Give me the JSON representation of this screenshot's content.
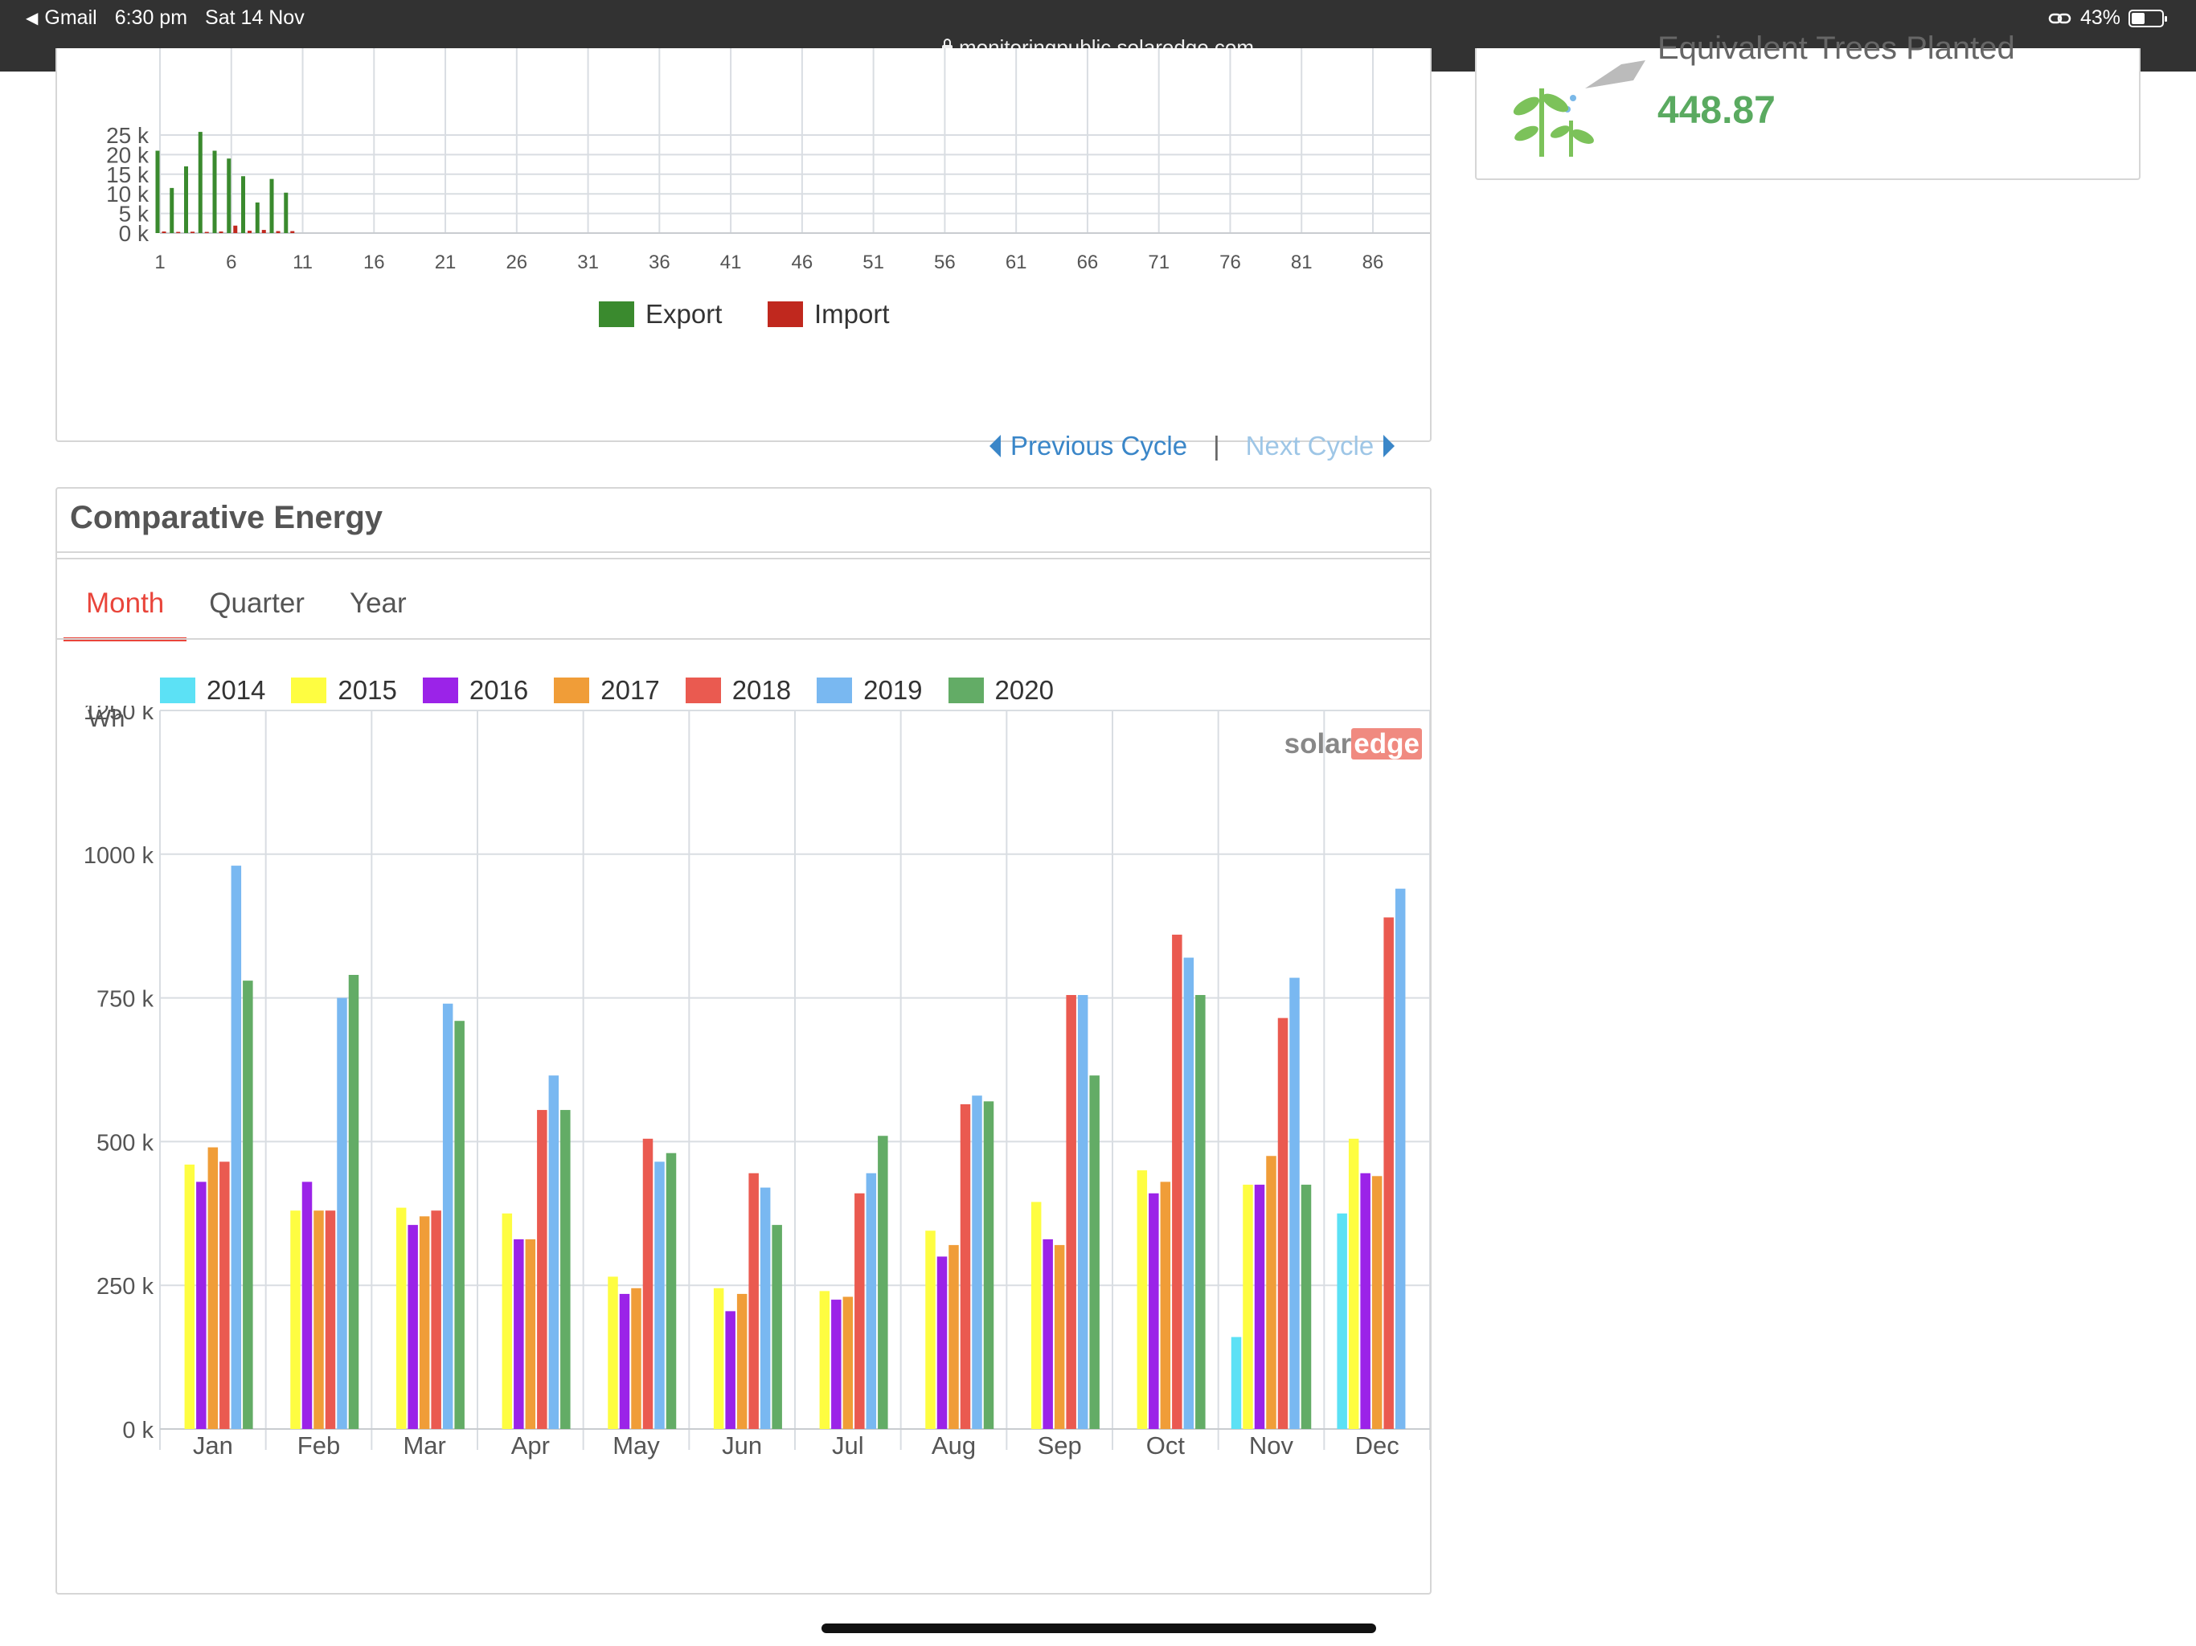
{
  "status_bar": {
    "back_app": "Gmail",
    "time": "6:30 pm",
    "date": "Sat 14 Nov",
    "battery": "43%",
    "url": "monitoringpublic.solaredge.com"
  },
  "trees": {
    "label": "Equivalent Trees Planted",
    "value": "448.87"
  },
  "cycle": {
    "prev_label": "Previous Cycle",
    "separator": "|",
    "next_label": "Next Cycle"
  },
  "comparative": {
    "title": "Comparative Energy",
    "unit": "Wh",
    "brand_a": "solar",
    "brand_b": "edge"
  },
  "tabs": [
    {
      "label": "Month"
    },
    {
      "label": "Quarter"
    },
    {
      "label": "Year"
    }
  ],
  "colors": {
    "export": "#3a8a2e",
    "import": "#c0281e",
    "tab_active": "#e9453b",
    "link": "#3a86c8",
    "value_green": "#5aaa60"
  },
  "chart_data": [
    {
      "type": "bar",
      "ylim": [
        0,
        25000
      ],
      "y_ticks": [
        0,
        5000,
        10000,
        15000,
        20000,
        25000
      ],
      "y_tick_labels": [
        "0 k",
        "5 k",
        "10 k",
        "15 k",
        "20 k",
        "25 k"
      ],
      "x_tick_labels": [
        "1",
        "6",
        "11",
        "16",
        "21",
        "26",
        "31",
        "36",
        "41",
        "46",
        "51",
        "56",
        "61",
        "66",
        "71",
        "76",
        "81",
        "86"
      ],
      "x_range": [
        1,
        90
      ],
      "legend_position": "bottom",
      "series": [
        {
          "name": "Export",
          "color": "#3a8a2e",
          "x": [
            1,
            2,
            3,
            4,
            5,
            6,
            7,
            8,
            9,
            10
          ],
          "values": [
            21000,
            11500,
            17000,
            25800,
            21000,
            19000,
            14500,
            7800,
            13800,
            10300
          ]
        },
        {
          "name": "Import",
          "color": "#c0281e",
          "x": [
            1,
            2,
            3,
            4,
            5,
            6,
            7,
            8,
            9,
            10
          ],
          "values": [
            400,
            300,
            350,
            300,
            400,
            1900,
            600,
            800,
            500,
            500
          ]
        }
      ]
    },
    {
      "type": "bar",
      "ylabel": "Wh",
      "ylim": [
        0,
        1250000
      ],
      "y_ticks": [
        0,
        250000,
        500000,
        750000,
        1000000,
        1250000
      ],
      "y_tick_labels": [
        "0 k",
        "250 k",
        "500 k",
        "750 k",
        "1000 k",
        "1250 k"
      ],
      "categories": [
        "Jan",
        "Feb",
        "Mar",
        "Apr",
        "May",
        "Jun",
        "Jul",
        "Aug",
        "Sep",
        "Oct",
        "Nov",
        "Dec"
      ],
      "legend_position": "top",
      "series": [
        {
          "name": "2014",
          "color": "#5ce1f5",
          "values": [
            null,
            null,
            null,
            null,
            null,
            null,
            null,
            null,
            null,
            null,
            160000,
            375000
          ]
        },
        {
          "name": "2015",
          "color": "#fefd41",
          "values": [
            460000,
            380000,
            385000,
            375000,
            265000,
            245000,
            240000,
            345000,
            395000,
            450000,
            425000,
            505000
          ]
        },
        {
          "name": "2016",
          "color": "#9b23e8",
          "values": [
            430000,
            430000,
            355000,
            330000,
            235000,
            205000,
            225000,
            300000,
            330000,
            410000,
            425000,
            445000
          ]
        },
        {
          "name": "2017",
          "color": "#f09d38",
          "values": [
            490000,
            380000,
            370000,
            330000,
            245000,
            235000,
            230000,
            320000,
            320000,
            430000,
            475000,
            440000
          ]
        },
        {
          "name": "2018",
          "color": "#ea5a50",
          "values": [
            465000,
            380000,
            380000,
            555000,
            505000,
            445000,
            410000,
            565000,
            755000,
            860000,
            715000,
            890000
          ]
        },
        {
          "name": "2019",
          "color": "#79b8f1",
          "values": [
            980000,
            750000,
            740000,
            615000,
            465000,
            420000,
            445000,
            580000,
            755000,
            820000,
            785000,
            940000
          ]
        },
        {
          "name": "2020",
          "color": "#63ac66",
          "values": [
            780000,
            790000,
            710000,
            555000,
            480000,
            355000,
            510000,
            570000,
            615000,
            755000,
            425000,
            null
          ]
        }
      ]
    }
  ]
}
